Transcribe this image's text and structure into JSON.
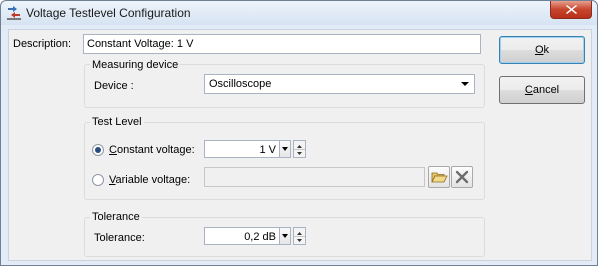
{
  "window": {
    "title": "Voltage Testlevel Configuration",
    "icon": "voltage-testlevel-app-icon",
    "close_icon": "close-icon"
  },
  "description": {
    "label": "Description:",
    "value": "Constant Voltage: 1 V"
  },
  "measuring_device": {
    "group_title": "Measuring device",
    "device_label": "Device :",
    "device_value": "Oscilloscope"
  },
  "test_level": {
    "group_title": "Test Level",
    "constant": {
      "label_mnemonic": "C",
      "label_rest": "onstant voltage:",
      "value": "1 V",
      "selected": true
    },
    "variable": {
      "label_mnemonic": "V",
      "label_rest": "ariable voltage:",
      "value": "",
      "selected": false
    },
    "open_icon": "folder-open-icon",
    "clear_icon": "delete-x-icon"
  },
  "tolerance": {
    "group_title": "Tolerance",
    "label": "Tolerance:",
    "value": "0,2 dB"
  },
  "buttons": {
    "ok_mnemonic": "O",
    "ok_rest": "k",
    "cancel_mnemonic": "C",
    "cancel_rest": "ancel"
  }
}
